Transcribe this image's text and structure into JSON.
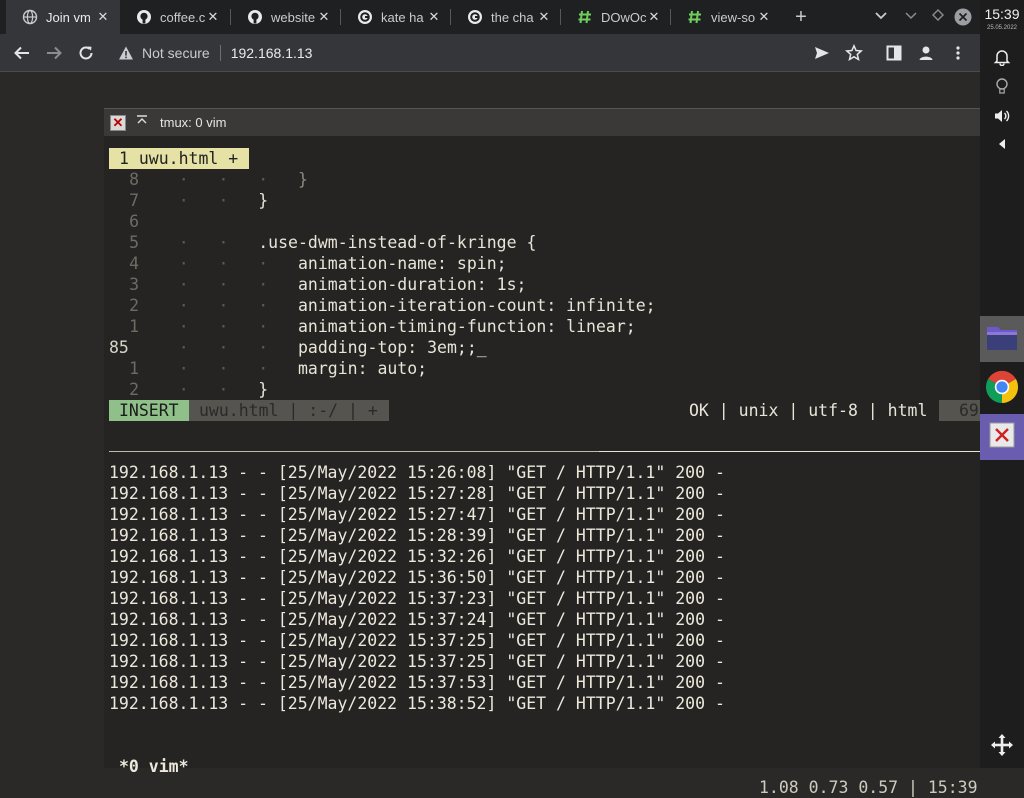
{
  "browser": {
    "tabs": [
      {
        "title": "Join vm",
        "icon": "globe-icon",
        "active": true
      },
      {
        "title": "coffee.c",
        "icon": "github-icon"
      },
      {
        "title": "website",
        "icon": "github-icon"
      },
      {
        "title": "kate ha",
        "icon": "google-icon"
      },
      {
        "title": "the cha",
        "icon": "google-icon"
      },
      {
        "title": "DOwOc",
        "icon": "hash-icon"
      },
      {
        "title": "view-so",
        "icon": "hash-icon"
      }
    ],
    "new_tab": "+",
    "security_label": "Not secure",
    "url": "192.168.1.13"
  },
  "panel": {
    "time": "15:39",
    "date": "25.05.2022"
  },
  "terminal": {
    "title": "tmux: 0 vim",
    "vim_tab": "1 uwu.html +",
    "code_lines": [
      {
        "num": "8",
        "guides": "·   ·   ·   ",
        "text": "}",
        "dim": true
      },
      {
        "num": "7",
        "guides": "·   ·   ",
        "text": "}"
      },
      {
        "num": "6",
        "guides": "",
        "text": ""
      },
      {
        "num": "5",
        "guides": "·   ·   ",
        "text": ".use-dwm-instead-of-kringe {"
      },
      {
        "num": "4",
        "guides": "·   ·   ·   ",
        "text": "animation-name: spin;"
      },
      {
        "num": "3",
        "guides": "·   ·   ·   ",
        "text": "animation-duration: 1s;"
      },
      {
        "num": "2",
        "guides": "·   ·   ·   ",
        "text": "animation-iteration-count: infinite;"
      },
      {
        "num": "1",
        "guides": "·   ·   ·   ",
        "text": "animation-timing-function: linear;"
      },
      {
        "num": "85",
        "guides": "·   ·   ·   ",
        "text": "padding-top: 3em;;_",
        "current": true
      },
      {
        "num": "1",
        "guides": "·   ·   ·   ",
        "text": "margin: auto;"
      },
      {
        "num": "2",
        "guides": "·   ·   ",
        "text": "}"
      }
    ],
    "status": {
      "mode": "INSERT",
      "file": "uwu.html | :-/ | +",
      "info": "OK | unix | utf-8 | html",
      "percent": "69"
    },
    "log_lines": [
      "192.168.1.13 - - [25/May/2022 15:26:08] \"GET / HTTP/1.1\" 200 -",
      "192.168.1.13 - - [25/May/2022 15:27:28] \"GET / HTTP/1.1\" 200 -",
      "192.168.1.13 - - [25/May/2022 15:27:47] \"GET / HTTP/1.1\" 200 -",
      "192.168.1.13 - - [25/May/2022 15:28:39] \"GET / HTTP/1.1\" 200 -",
      "192.168.1.13 - - [25/May/2022 15:32:26] \"GET / HTTP/1.1\" 200 -",
      "192.168.1.13 - - [25/May/2022 15:36:50] \"GET / HTTP/1.1\" 200 -",
      "192.168.1.13 - - [25/May/2022 15:37:23] \"GET / HTTP/1.1\" 200 -",
      "192.168.1.13 - - [25/May/2022 15:37:24] \"GET / HTTP/1.1\" 200 -",
      "192.168.1.13 - - [25/May/2022 15:37:25] \"GET / HTTP/1.1\" 200 -",
      "192.168.1.13 - - [25/May/2022 15:37:25] \"GET / HTTP/1.1\" 200 -",
      "192.168.1.13 - - [25/May/2022 15:37:53] \"GET / HTTP/1.1\" 200 -",
      "192.168.1.13 - - [25/May/2022 15:38:52] \"GET / HTTP/1.1\" 200 -"
    ],
    "tmux_left": "*0 vim*",
    "tmux_right": "1.08 0.73 0.57 | 15:39"
  }
}
